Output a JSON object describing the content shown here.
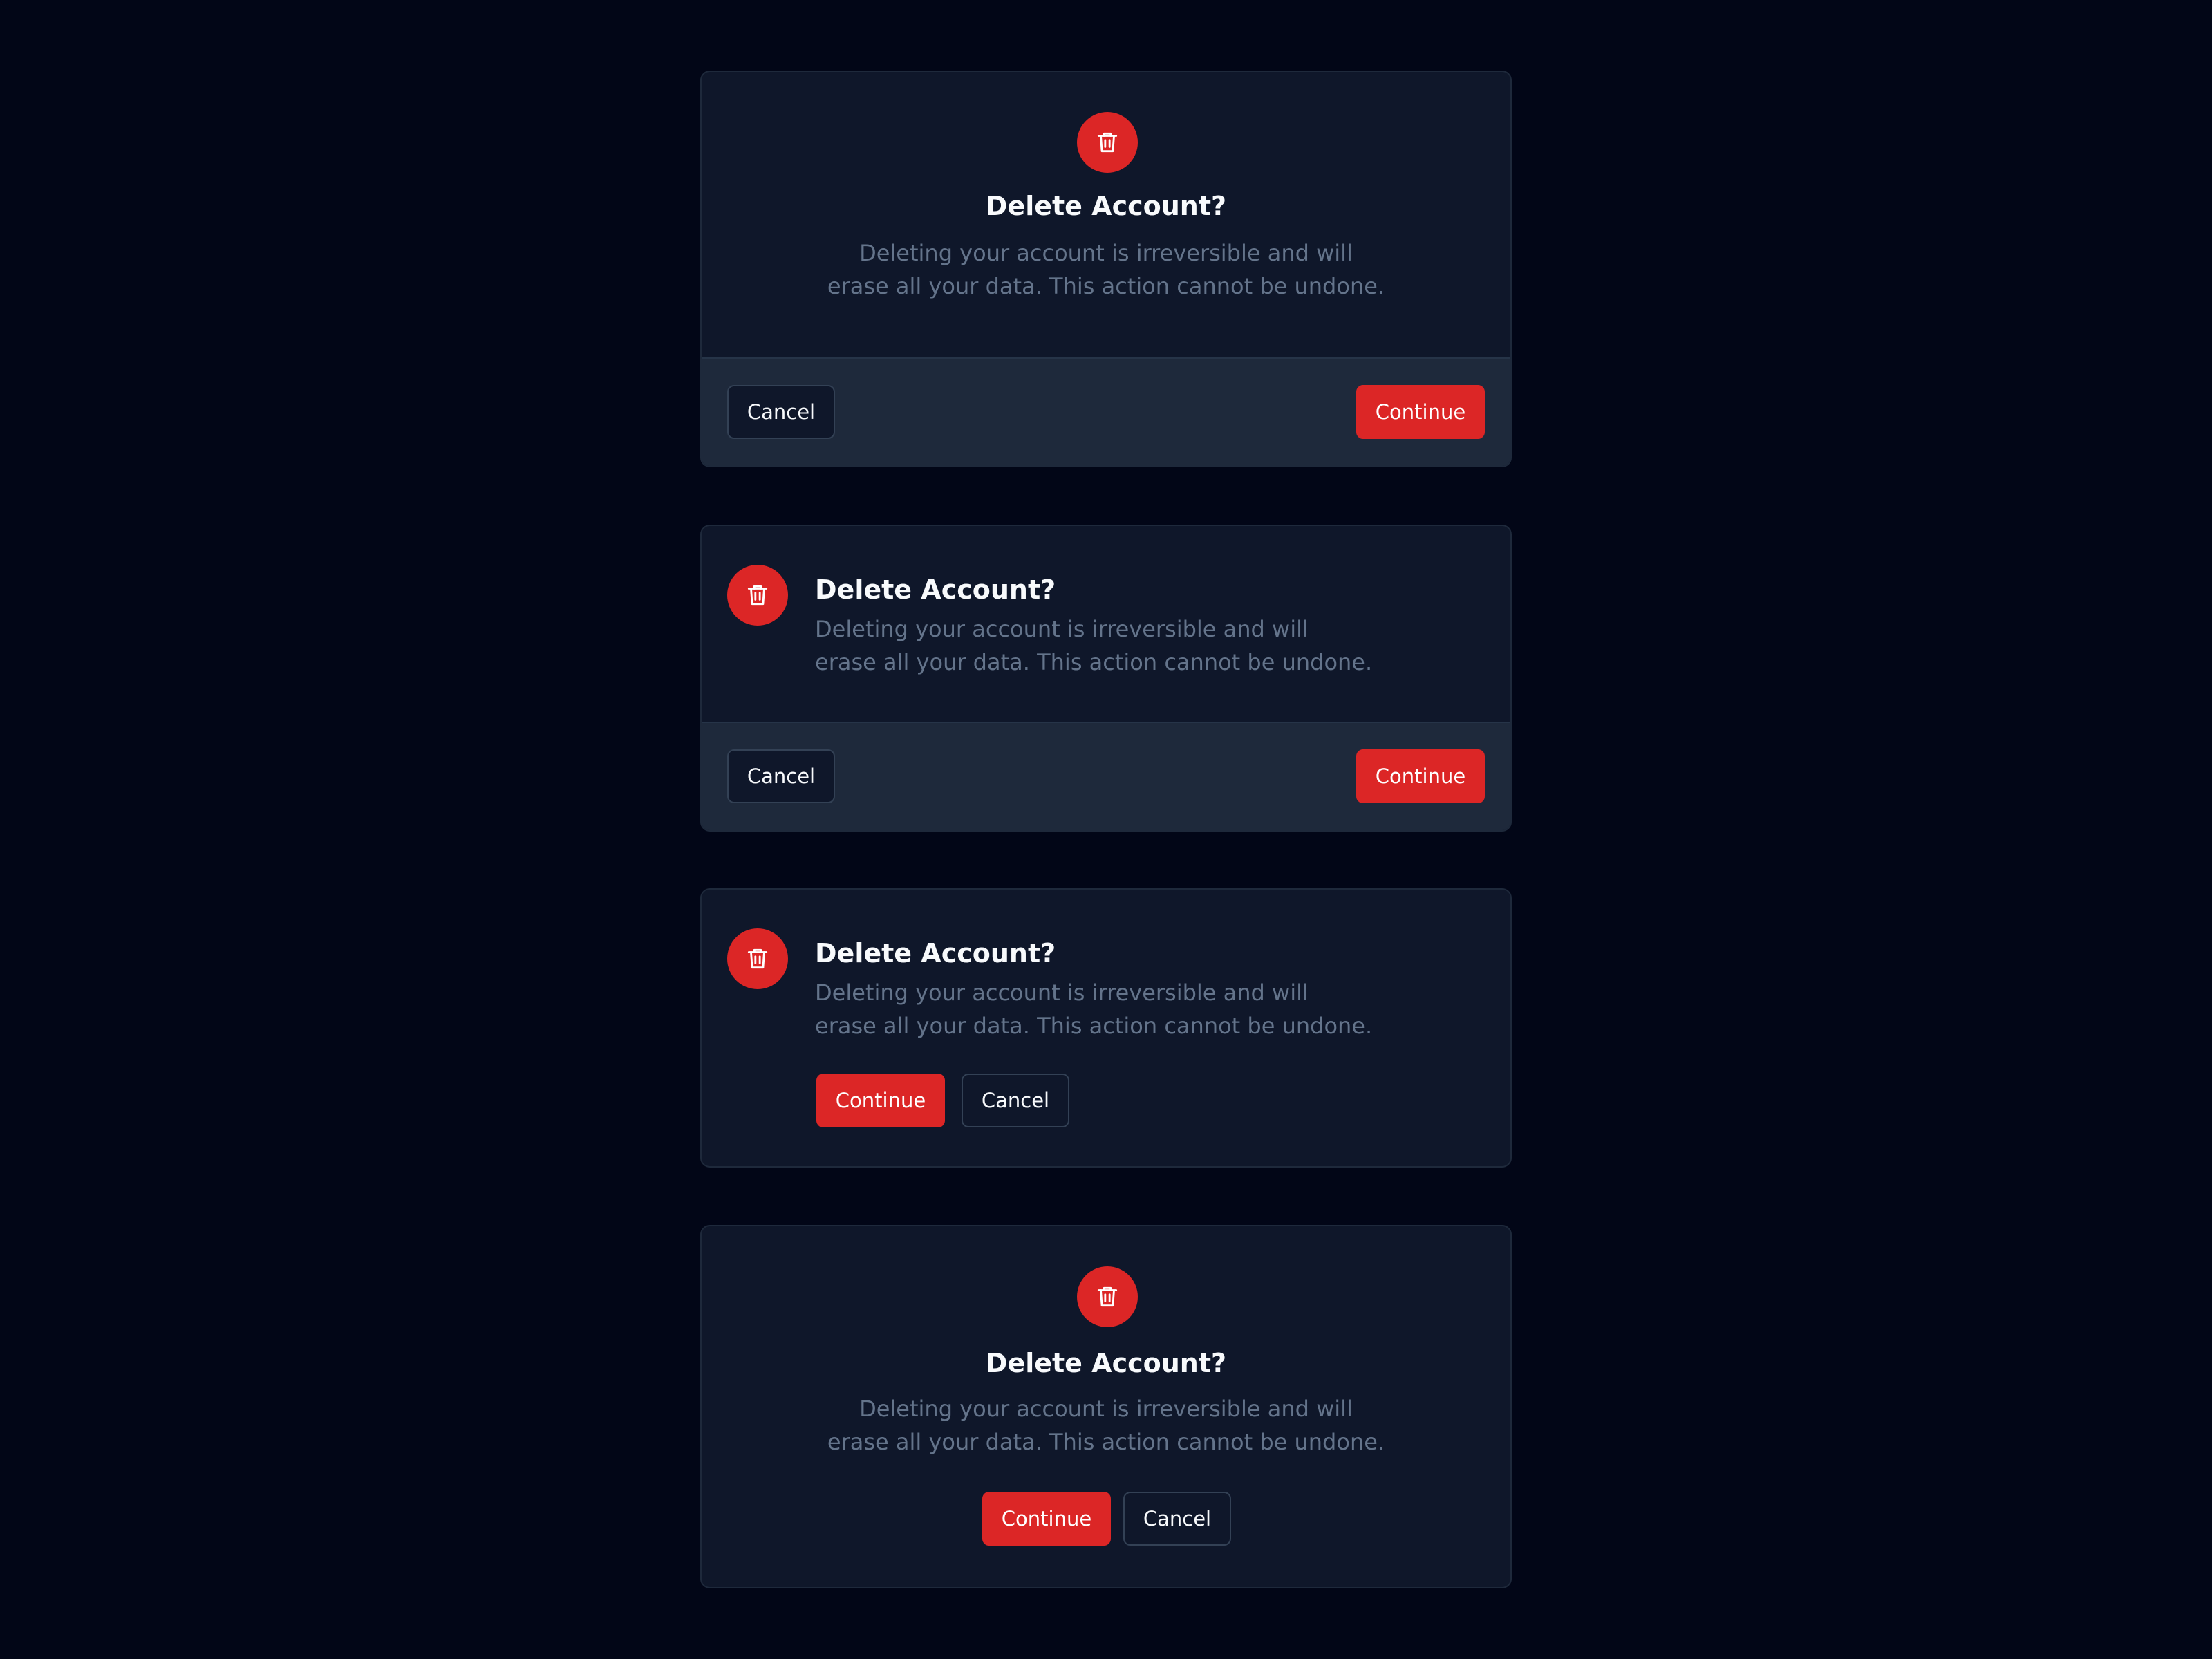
{
  "colors": {
    "background": "#020617",
    "card": "#0f172a",
    "footer": "#1e293b",
    "danger": "#dc2626",
    "title": "#f8fafc",
    "description": "#64748b"
  },
  "dialogs": [
    {
      "layout": "centered-with-footer",
      "icon": "trash-icon",
      "title": "Delete Account?",
      "description_line1": "Deleting your account is irreversible and will",
      "description_line2": "erase all your data. This action cannot be undone.",
      "cancel_label": "Cancel",
      "continue_label": "Continue"
    },
    {
      "layout": "left-aligned-with-footer",
      "icon": "trash-icon",
      "title": "Delete Account?",
      "description_line1": "Deleting your account is irreversible and will",
      "description_line2": "erase all your data. This action cannot be undone.",
      "cancel_label": "Cancel",
      "continue_label": "Continue"
    },
    {
      "layout": "left-aligned-inline-actions",
      "icon": "trash-icon",
      "title": "Delete Account?",
      "description_line1": "Deleting your account is irreversible and will",
      "description_line2": "erase all your data. This action cannot be undone.",
      "continue_label": "Continue",
      "cancel_label": "Cancel"
    },
    {
      "layout": "centered-inline-actions",
      "icon": "trash-icon",
      "title": "Delete Account?",
      "description_line1": "Deleting your account is irreversible and will",
      "description_line2": "erase all your data. This action cannot be undone.",
      "continue_label": "Continue",
      "cancel_label": "Cancel"
    }
  ]
}
